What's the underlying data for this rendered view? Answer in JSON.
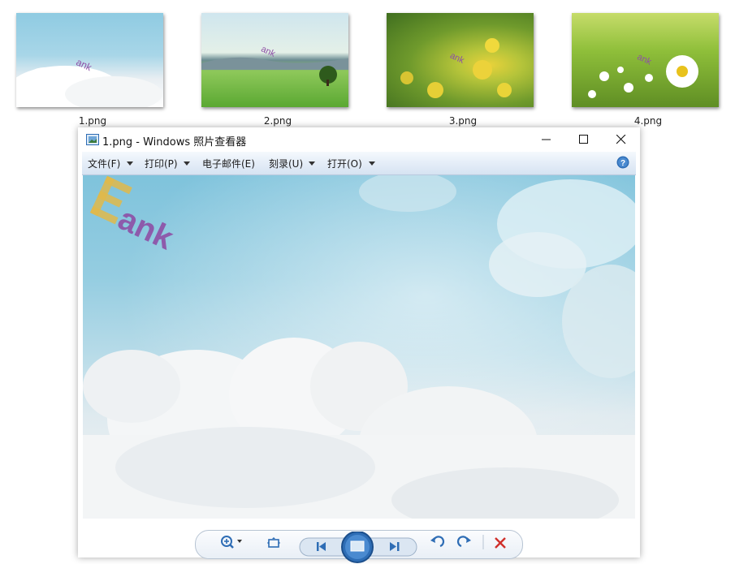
{
  "thumbnails": [
    {
      "label": "1.png"
    },
    {
      "label": "2.png"
    },
    {
      "label": "3.png"
    },
    {
      "label": "4.png"
    }
  ],
  "viewer": {
    "title": "1.png - Windows 照片查看器",
    "menu": [
      {
        "label": "文件(F)",
        "has_dropdown": true
      },
      {
        "label": "打印(P)",
        "has_dropdown": true
      },
      {
        "label": "电子邮件(E)",
        "has_dropdown": false
      },
      {
        "label": "刻录(U)",
        "has_dropdown": true
      },
      {
        "label": "打开(O)",
        "has_dropdown": true
      }
    ],
    "help_icon": "help-icon",
    "image_watermark": "ank",
    "controls": [
      "zoom-icon",
      "fit-window-icon",
      "previous-icon",
      "slideshow-icon",
      "next-icon",
      "rotate-left-icon",
      "rotate-right-icon",
      "delete-icon"
    ]
  },
  "colors": {
    "menubar": "#e3ecf7",
    "accent_blue": "#2e6db5",
    "delete_red": "#d0302b",
    "watermark_purple": "#8e4fa6",
    "watermark_gold": "#e1b84a"
  }
}
